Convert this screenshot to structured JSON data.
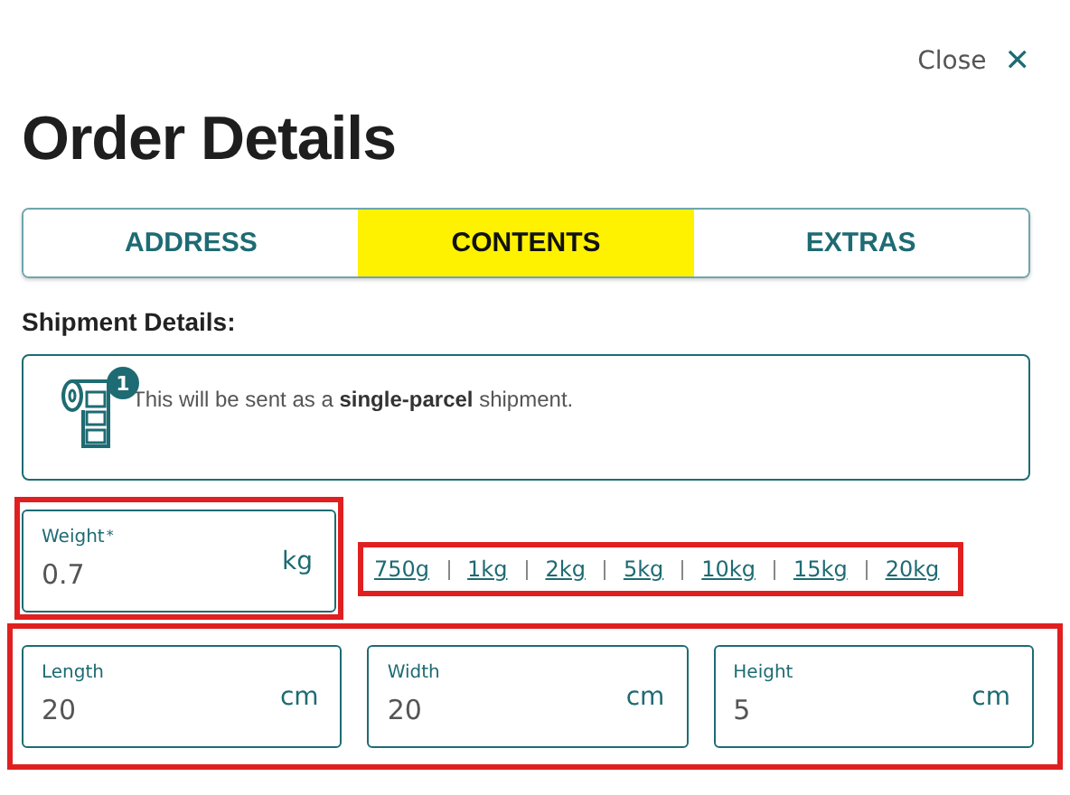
{
  "close": {
    "label": "Close",
    "icon": "✕"
  },
  "title": "Order Details",
  "tabs": [
    {
      "label": "ADDRESS",
      "selected": false
    },
    {
      "label": "CONTENTS",
      "selected": true
    },
    {
      "label": "EXTRAS",
      "selected": false
    }
  ],
  "section_heading": "Shipment Details:",
  "notice": {
    "badge": "1",
    "text": "This will be sent as a **single-parcel** shipment."
  },
  "weight": {
    "label": "Weight",
    "required_mark": "*",
    "value": "0.7",
    "unit": "kg",
    "highlighted": true
  },
  "presets": {
    "highlighted": true,
    "items": [
      "750g",
      "1kg",
      "2kg",
      "5kg",
      "10kg",
      "15kg",
      "20kg"
    ]
  },
  "dimensions": {
    "highlighted": true,
    "fields": [
      {
        "label": "Length",
        "value": "20",
        "unit": "cm"
      },
      {
        "label": "Width",
        "value": "20",
        "unit": "cm"
      },
      {
        "label": "Height",
        "value": "5",
        "unit": "cm"
      }
    ]
  }
}
